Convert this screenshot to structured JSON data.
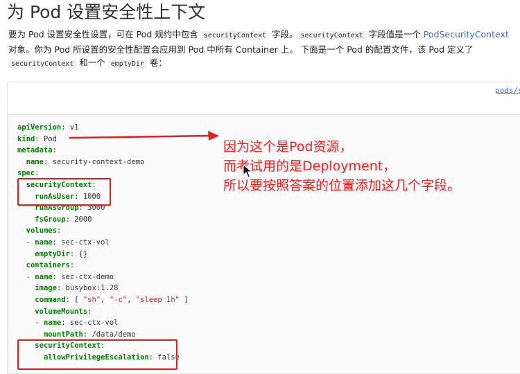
{
  "page_title": "为 Pod 设置安全性上下文",
  "intro": {
    "t1": "要为 Pod 设置安全性设置，可在 Pod 规约中包含 ",
    "c1": "securityContext",
    "t2": " 字段。",
    "c2": "securityContext",
    "t3": " 字段值是一个 ",
    "link": "PodSecurityContext",
    "t4": " 对象。你为 Pod 所设置的安全性配置会应用到 Pod 中所有 Container 上。 下面是一个 Pod 的配置文件，该 Pod 定义了 ",
    "c3": "securityContext",
    "t5": " 和一个 ",
    "c4": "emptyDir",
    "t6": " 卷："
  },
  "file_path": "pods/se",
  "code_lines": [
    {
      "key": "apiVersion",
      "indent": "",
      "val": " v1"
    },
    {
      "key": "kind",
      "indent": "",
      "val": " Pod"
    },
    {
      "key": "metadata",
      "indent": "",
      "val": ""
    },
    {
      "key": "name",
      "indent": "  ",
      "val": " security-context-demo"
    },
    {
      "key": "spec",
      "indent": "",
      "val": ""
    },
    {
      "key": "securityContext",
      "indent": "  ",
      "val": ""
    },
    {
      "key": "runAsUser",
      "indent": "    ",
      "val": " 1000"
    },
    {
      "key": "runAsGroup",
      "indent": "    ",
      "val": " 3000"
    },
    {
      "key": "fsGroup",
      "indent": "    ",
      "val": " 2000"
    },
    {
      "key": "volumes",
      "indent": "  ",
      "val": ""
    },
    {
      "key": "name",
      "indent": "  - ",
      "val": " sec-ctx-vol"
    },
    {
      "key": "emptyDir",
      "indent": "    ",
      "val": " {}"
    },
    {
      "key": "containers",
      "indent": "  ",
      "val": ""
    },
    {
      "key": "name",
      "indent": "  - ",
      "val": " sec-ctx-demo"
    },
    {
      "key": "image",
      "indent": "    ",
      "val": " busybox:1.28"
    },
    {
      "key": "command",
      "indent": "    ",
      "val": " [ ",
      "strings": [
        "\"sh\"",
        "\"-c\"",
        "\"sleep 1h\""
      ],
      "tail": " ]"
    },
    {
      "key": "volumeMounts",
      "indent": "    ",
      "val": ""
    },
    {
      "key": "name",
      "indent": "    - ",
      "val": " sec-ctx-vol"
    },
    {
      "key": "mountPath",
      "indent": "      ",
      "val": " /data/demo"
    },
    {
      "key": "securityContext",
      "indent": "    ",
      "val": ""
    },
    {
      "key": "allowPrivilegeEscalation",
      "indent": "      ",
      "val": " false"
    }
  ],
  "annotation": {
    "line1": "因为这个是Pod资源，",
    "line2": "而考试用的是Deployment，",
    "line3": "所以要按照答案的位置添加这几个字段。",
    "color": "#ff1a1a"
  },
  "colors": {
    "key": "#008000",
    "string": "#ba2121",
    "link": "#326ce5",
    "highlight_box": "#e02020"
  }
}
